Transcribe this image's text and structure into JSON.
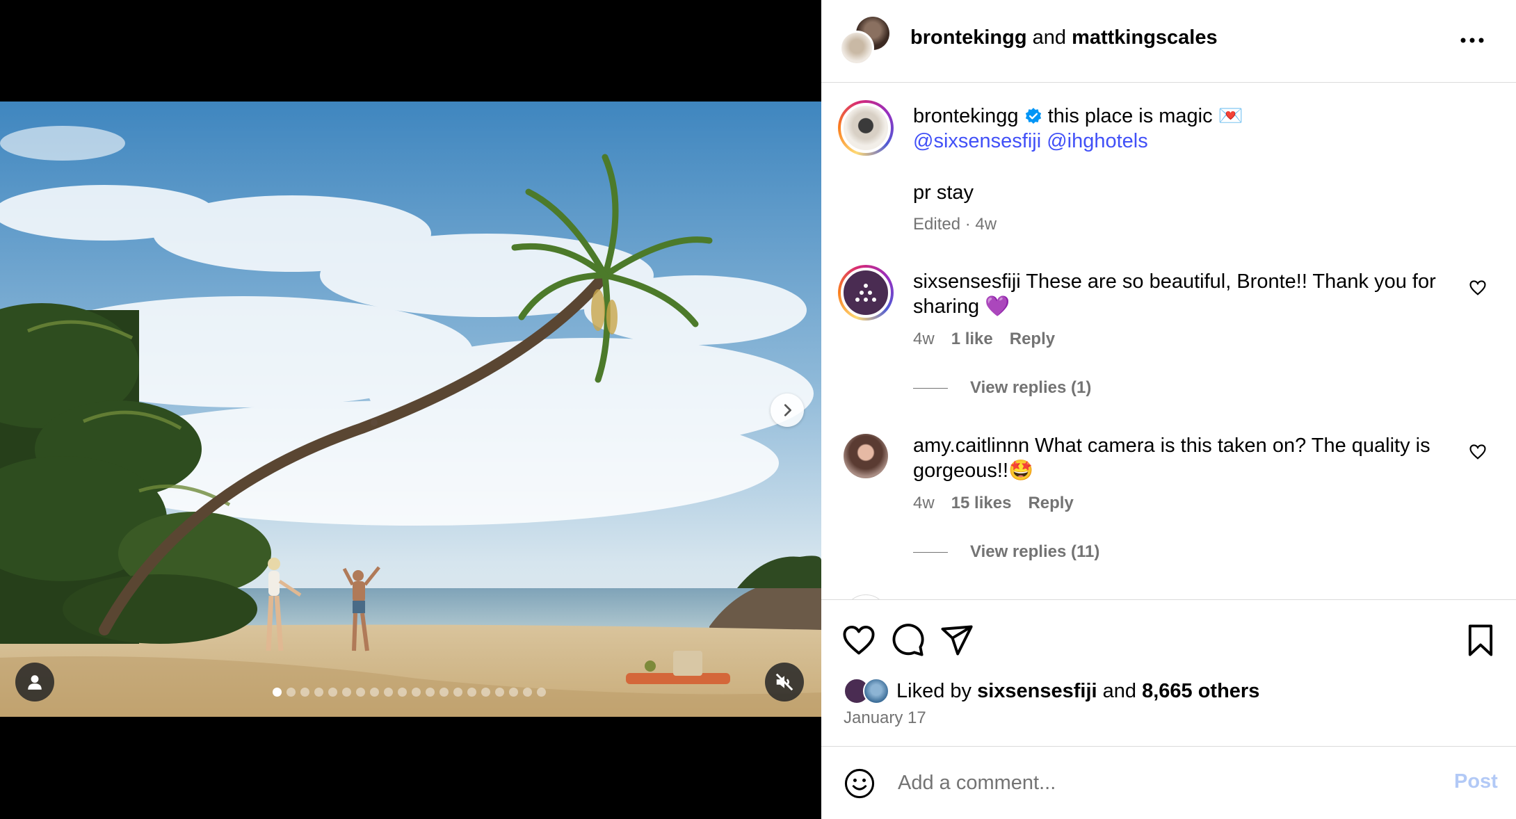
{
  "header": {
    "user1": "brontekingg",
    "connector": "and",
    "user2": "mattkingscales",
    "more_icon": "more-horizontal-icon"
  },
  "caption": {
    "username": "brontekingg",
    "verified_icon": "verified-badge-icon",
    "text": "this place is magic",
    "emoji": "💌",
    "mention1": "@sixsensesfiji",
    "mention2": "@ihghotels",
    "line2": "pr stay",
    "meta": "Edited · 4w"
  },
  "comments": [
    {
      "username": "sixsensesfiji",
      "text": "These are so beautiful, Bronte!! Thank you for",
      "text2": "sharing 💜",
      "age": "4w",
      "likes": "1 like",
      "reply": "Reply",
      "view_replies": "View replies (1)"
    },
    {
      "username": "amy.caitlinnn",
      "text": "What camera is this taken on? The quality is",
      "text2": "gorgeous!!🤩",
      "age": "4w",
      "likes": "15 likes",
      "reply": "Reply",
      "view_replies": "View replies (11)"
    }
  ],
  "actions": {
    "like_icon": "heart-icon",
    "comment_icon": "comment-icon",
    "share_icon": "share-icon",
    "save_icon": "bookmark-icon",
    "liked_prefix": "Liked by",
    "liked_user": "sixsensesfiji",
    "liked_and": "and",
    "liked_others": "8,665 others",
    "date": "January 17"
  },
  "comment_box": {
    "placeholder": "Add a comment...",
    "post_label": "Post"
  },
  "media": {
    "carousel_count": 20,
    "active_index": 0,
    "muted": true
  },
  "colors": {
    "mention": "#4150f7",
    "verified": "#0095f6",
    "post_disabled": "#b2c9f6"
  }
}
